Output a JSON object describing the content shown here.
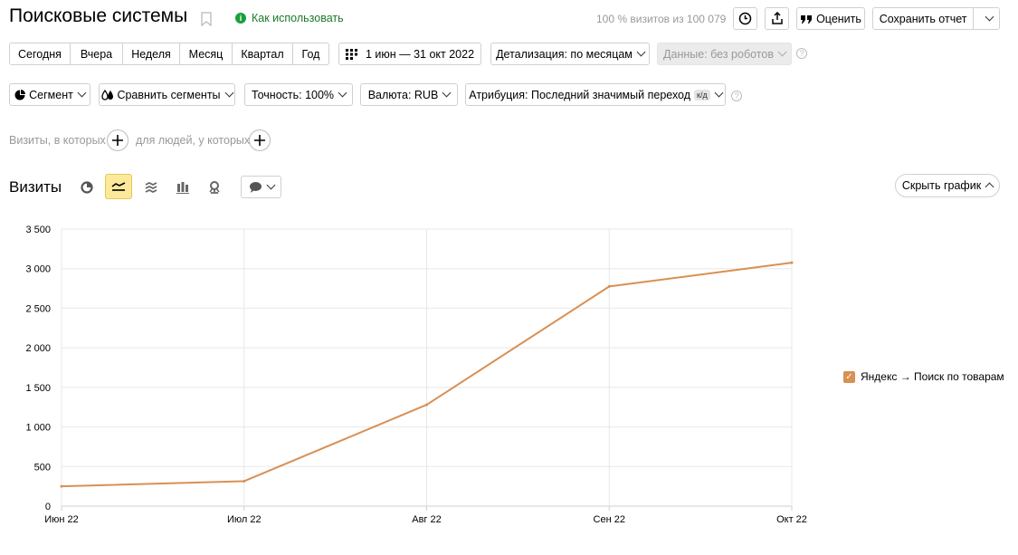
{
  "header": {
    "title": "Поисковые системы",
    "howto_label": "Как использовать",
    "visits_info": "100 % визитов из 100 079",
    "rate_label": "Оценить",
    "save_report_label": "Сохранить отчет"
  },
  "periods": [
    "Сегодня",
    "Вчера",
    "Неделя",
    "Месяц",
    "Квартал",
    "Год"
  ],
  "date_range": "1 июн — 31 окт 2022",
  "detail_label": "Детализация: по месяцам",
  "data_label": "Данные: без роботов",
  "filters": {
    "segment": "Сегмент",
    "compare": "Сравнить сегменты",
    "accuracy": "Точность: 100%",
    "currency": "Валюта: RUB",
    "attribution": "Атрибуция: Последний значимый переход",
    "attribution_badge": "к/д"
  },
  "conditions": {
    "visits_where": "Визиты, в которых",
    "people_where": "для людей, у которых"
  },
  "chart_header": {
    "metric": "Визиты",
    "hide_chart": "Скрыть график"
  },
  "chart_data": {
    "type": "line",
    "categories": [
      "Июн 22",
      "Июл 22",
      "Авг 22",
      "Сен 22",
      "Окт 22"
    ],
    "ylim": [
      0,
      3500
    ],
    "yticks": [
      "0",
      "500",
      "1 000",
      "1 500",
      "2 000",
      "2 500",
      "3 000",
      "3 500"
    ],
    "grid": true,
    "legend_position": "right",
    "series": [
      {
        "name": "Яндекс → Поиск по товарам",
        "color": "#d89053",
        "values": [
          250,
          315,
          1280,
          2775,
          3075
        ]
      }
    ]
  }
}
